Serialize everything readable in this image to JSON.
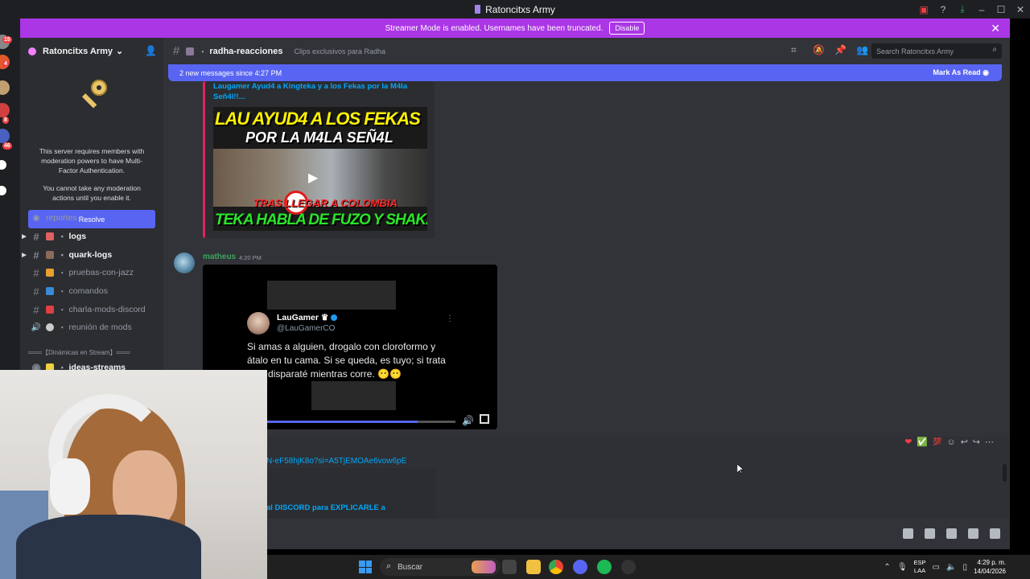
{
  "window": {
    "title": "Ratoncitxs Army"
  },
  "banner": {
    "text": "Streamer Mode is enabled. Usernames have been truncated.",
    "button": "Disable"
  },
  "servers": {
    "badges": [
      "15",
      "4",
      "8",
      "46"
    ]
  },
  "sidebar": {
    "server_name": "Ratoncitxs Army",
    "mfa_text": "This server requires members with moderation powers to have Multi-Factor Authentication.",
    "mfa_text2": "You cannot take any moderation actions until you enable it.",
    "resolve": "Resolve",
    "channels": [
      {
        "name": "reportes"
      },
      {
        "name": "logs"
      },
      {
        "name": "quark-logs"
      },
      {
        "name": "pruebas-con-jazz"
      },
      {
        "name": "comandos"
      },
      {
        "name": "charla-mods-discord"
      },
      {
        "name": "reunión de mods"
      },
      {
        "name": "ideas-streams"
      }
    ],
    "category": "═══【Dinámicas en Stream】═══"
  },
  "header": {
    "channel": "radha-reacciones",
    "topic": "Clips exclusivos para Radha",
    "search_placeholder": "Search Ratoncitxs Army"
  },
  "newmsgs": {
    "text": "2 new messages since 4:27 PM",
    "mark": "Mark As Read"
  },
  "embed1": {
    "title": "Laugamer Ayud4 a Kingteka y a los Fekas por la M4la Señ4l!!...",
    "thumb_line1": "LAU AYUD4 A LOS FEKAS",
    "thumb_line2": "POR LA M4LA SEÑ4L",
    "thumb_line3": "TRAS LLEGAR A COLOMBIA",
    "thumb_line4": "TEKA HABLA DE FUZO Y SHAKA"
  },
  "message": {
    "author": "matheus",
    "time": "4:20 PM",
    "tweet_name": "LauGamer",
    "tweet_handle": "@LauGamerCO",
    "tweet_text": "Si amas a alguien, drogalo con cloroformo y átalo en tu cama. Si se queda, es tuyo; si trata huir, disparaté mientras corre. 😶😶",
    "progress_fraction": 0.8
  },
  "next": {
    "link": "N-eF58hjK8o?si=A5TjEMOAe6vow6pE",
    "embed_title": "al DISCORD para EXPLICARLE a"
  },
  "taskbar": {
    "search": "Buscar",
    "lang1": "ESP",
    "lang2": "LAA",
    "time": "4:29 p. m.",
    "date": "14/04/2026"
  },
  "colors": {
    "banner": "#ab36e6",
    "accent": "#5865f2",
    "author": "#3ba55c",
    "link": "#00a8fc"
  }
}
